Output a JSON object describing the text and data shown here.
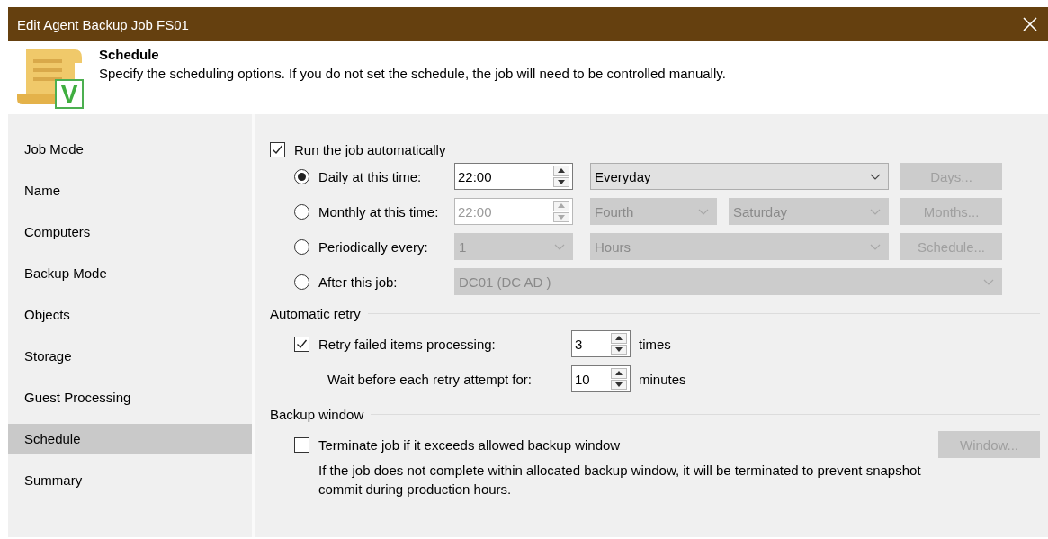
{
  "window": {
    "title": "Edit Agent Backup Job FS01"
  },
  "header": {
    "title": "Schedule",
    "description": "Specify the scheduling options. If you do not set the schedule, the job will need to be controlled manually.",
    "icon_letter": "V"
  },
  "sidebar": {
    "items": [
      {
        "label": "Job Mode",
        "selected": false
      },
      {
        "label": "Name",
        "selected": false
      },
      {
        "label": "Computers",
        "selected": false
      },
      {
        "label": "Backup Mode",
        "selected": false
      },
      {
        "label": "Objects",
        "selected": false
      },
      {
        "label": "Storage",
        "selected": false
      },
      {
        "label": "Guest Processing",
        "selected": false
      },
      {
        "label": "Schedule",
        "selected": true
      },
      {
        "label": "Summary",
        "selected": false
      }
    ]
  },
  "run_automatically": {
    "label": "Run the job automatically",
    "checked": true
  },
  "schedule_options": [
    {
      "kind": "daily",
      "label": "Daily at this time:",
      "selected": true,
      "controls": [
        {
          "kind": "spinner",
          "value": "22:00",
          "disabled": false
        },
        {
          "kind": "select",
          "value": "Everyday",
          "disabled": false
        },
        {
          "kind": "button",
          "value": "Days...",
          "disabled": true
        }
      ]
    },
    {
      "kind": "monthly",
      "label": "Monthly at this time:",
      "selected": false,
      "controls": [
        {
          "kind": "spinner",
          "value": "22:00",
          "disabled": true
        },
        {
          "kind": "select",
          "value": "Fourth",
          "disabled": true
        },
        {
          "kind": "select",
          "value": "Saturday",
          "disabled": true
        },
        {
          "kind": "button",
          "value": "Months...",
          "disabled": true
        }
      ]
    },
    {
      "kind": "periodic",
      "label": "Periodically every:",
      "selected": false,
      "controls": [
        {
          "kind": "select",
          "value": "1",
          "disabled": true
        },
        {
          "kind": "select",
          "value": "Hours",
          "disabled": true
        },
        {
          "kind": "button",
          "value": "Schedule...",
          "disabled": true
        }
      ]
    },
    {
      "kind": "after",
      "label": "After this job:",
      "selected": false,
      "controls": [
        {
          "kind": "select",
          "value": "DC01 (DC AD )",
          "disabled": true
        }
      ]
    }
  ],
  "automatic_retry": {
    "title": "Automatic retry",
    "retry": {
      "label": "Retry failed items processing:",
      "checked": true,
      "value": "3",
      "unit": "times"
    },
    "wait": {
      "label": "Wait before each retry attempt for:",
      "value": "10",
      "unit": "minutes"
    }
  },
  "backup_window": {
    "title": "Backup window",
    "terminate": {
      "label": "Terminate job if it exceeds allowed backup window",
      "checked": false
    },
    "button": {
      "label": "Window...",
      "disabled": true
    },
    "note": "If the job does not complete within allocated backup window, it will be terminated to prevent snapshot commit during production hours."
  }
}
